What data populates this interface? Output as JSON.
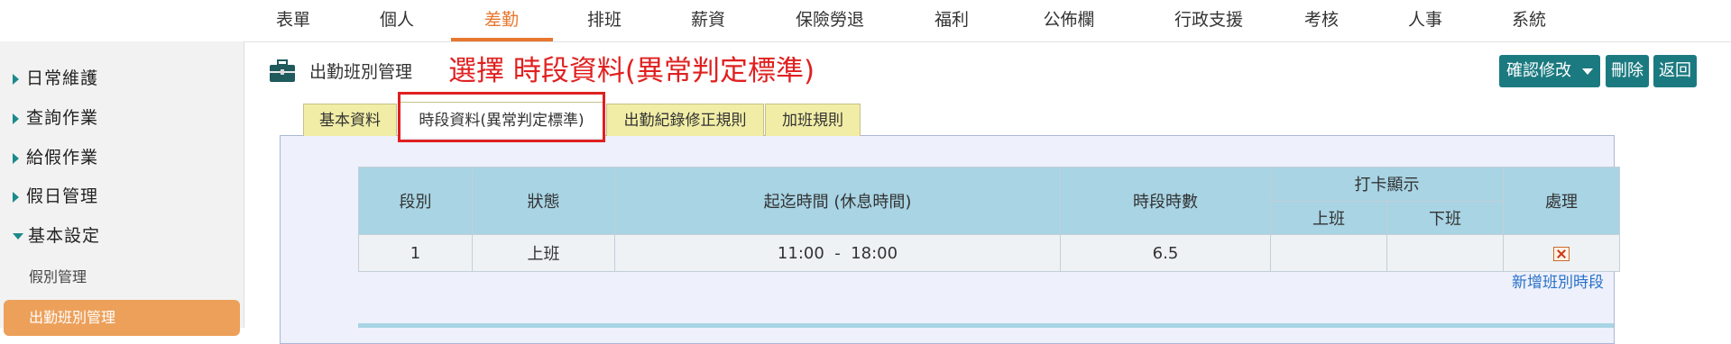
{
  "nav": {
    "items": [
      "表單",
      "個人",
      "差勤",
      "排班",
      "薪資",
      "保險勞退",
      "福利",
      "公佈欄",
      "行政支援",
      "考核",
      "人事",
      "系統"
    ],
    "active_index": 2
  },
  "sidebar": {
    "items": [
      "日常維護",
      "查詢作業",
      "給假作業",
      "假日管理"
    ],
    "expanded_label": "基本設定",
    "sub_items": [
      "假別管理",
      "出勤班別管理"
    ]
  },
  "header": {
    "title": "出勤班別管理",
    "annotation": "選擇 時段資料(異常判定標準)",
    "confirm_label": "確認修改",
    "delete_label": "刪除",
    "back_label": "返回"
  },
  "tabs": [
    "基本資料",
    "時段資料(異常判定標準)",
    "出勤紀錄修正規則",
    "加班規則"
  ],
  "active_tab_index": 1,
  "table": {
    "headers": {
      "segment": "段別",
      "status": "狀態",
      "time_range": "起迄時間 (休息時間)",
      "hours": "時段時數",
      "punch_display": "打卡顯示",
      "punch_in": "上班",
      "punch_out": "下班",
      "action": "處理"
    },
    "rows": [
      {
        "segment": "1",
        "status": "上班",
        "time_range": "11:00  -  18:00",
        "hours": "6.5",
        "punch_in": "",
        "punch_out": ""
      }
    ]
  },
  "add_segment_label": "新增班別時段",
  "colors": {
    "accent": "#e8772e",
    "teal_button": "#1b7a80",
    "annotation_red": "#e02020",
    "tab_bg": "#f1eda6",
    "header_blue": "#a8d4e4"
  },
  "icons": [
    "briefcase-icon",
    "delete-row-icon",
    "chevron-right-icon",
    "chevron-down-icon"
  ]
}
